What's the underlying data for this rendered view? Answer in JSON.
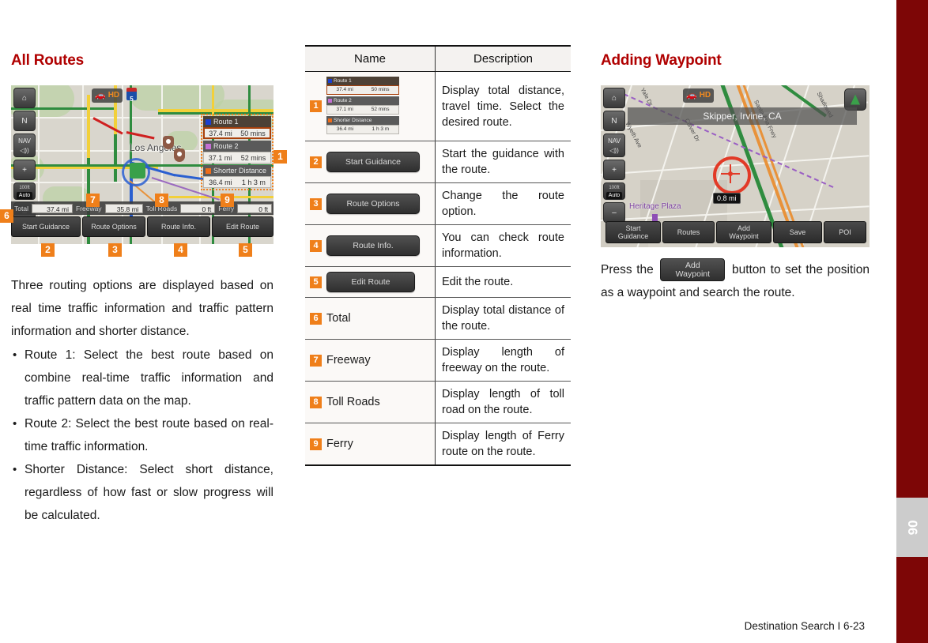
{
  "page": {
    "footer": "Destination Search I 6-23",
    "tab_number": "06",
    "spine_color": "#7d0606",
    "heading_color": "#b00000",
    "callout_color": "#ef7f1a"
  },
  "left": {
    "title": "All Routes",
    "intro": "Three routing options are displayed based on real time traffic information and traffic pattern information and shorter distance.",
    "bullets": [
      "Route 1: Select the best route based on combine real-time traffic information and traffic pattern data on the map.",
      "Route 2: Select the best route based on real-time traffic information.",
      "Shorter Distance: Select short distance, regardless of how fast or slow progress will be calculated."
    ],
    "screenshot": {
      "toolbar": {
        "home": "⌂",
        "north": "N",
        "nav_label": "NAV",
        "mute": "◁))",
        "zoom_in": "+",
        "zoom_out": "–",
        "scale_top": "100ft",
        "scale_auto": "Auto"
      },
      "traffic_badge": {
        "car": "Ὡ7",
        "hd": "HD"
      },
      "highway_shield": "5",
      "city_label": "Los Angeles",
      "routes": [
        {
          "name": "Route 1",
          "distance": "37.4 mi",
          "time": "50 mins",
          "color": "#1c3fd1",
          "selected": true
        },
        {
          "name": "Route 2",
          "distance": "37.1 mi",
          "time": "52 mins",
          "color": "#c46fd4",
          "selected": false
        },
        {
          "name": "Shorter Distance",
          "distance": "36.4 mi",
          "time": "1 h 3 m",
          "color": "#ef6c1a",
          "selected": false
        }
      ],
      "info_strip": [
        {
          "label": "Total",
          "value": "37.4 mi"
        },
        {
          "label": "Freeway",
          "value": "35.8 mi"
        },
        {
          "label": "Toll Roads",
          "value": "0 ft"
        },
        {
          "label": "Ferry",
          "value": "0 ft"
        }
      ],
      "buttons": [
        "Start Guidance",
        "Route Options",
        "Route Info.",
        "Edit Route"
      ],
      "callouts": [
        "1",
        "2",
        "3",
        "4",
        "5",
        "6",
        "7",
        "8",
        "9"
      ]
    }
  },
  "table": {
    "headers": [
      "Name",
      "Description"
    ],
    "rows": [
      {
        "num": "1",
        "kind": "route-stack",
        "routes": [
          {
            "name": "Route 1",
            "distance": "37.4 mi",
            "time": "50 mins",
            "color": "#1c3fd1",
            "selected": true
          },
          {
            "name": "Route 2",
            "distance": "37.1 mi",
            "time": "52 mins",
            "color": "#c46fd4",
            "selected": false
          },
          {
            "name": "Shorter Distance",
            "distance": "36.4 mi",
            "time": "1 h 3 m",
            "color": "#ef6c1a",
            "selected": false
          }
        ],
        "desc": "Display total distance, travel time. Select the desired route."
      },
      {
        "num": "2",
        "kind": "chip",
        "label": "Start Guidance",
        "chip_width": 118,
        "desc": "Start the guidance with the route."
      },
      {
        "num": "3",
        "kind": "chip",
        "label": "Route Options",
        "chip_width": 118,
        "desc": "Change the route option."
      },
      {
        "num": "4",
        "kind": "chip",
        "label": "Route Info.",
        "chip_width": 118,
        "desc": "You can check route information."
      },
      {
        "num": "5",
        "kind": "chip",
        "label": "Edit Route",
        "chip_width": 112,
        "desc": "Edit the route."
      },
      {
        "num": "6",
        "kind": "text",
        "label": "Total",
        "desc": "Display total distance of the route."
      },
      {
        "num": "7",
        "kind": "text",
        "label": "Freeway",
        "desc": "Display length of freeway on the route."
      },
      {
        "num": "8",
        "kind": "text",
        "label": "Toll Roads",
        "desc": "Display length of toll road on the route."
      },
      {
        "num": "9",
        "kind": "text",
        "label": "Ferry",
        "desc": "Display length of Ferry route on the route."
      }
    ]
  },
  "right": {
    "title": "Adding Waypoint",
    "paragraph_before": "Press the",
    "inline_button_line1": "Add",
    "inline_button_line2": "Waypoint",
    "paragraph_after": "button to set the position as a waypoint and search the route.",
    "screenshot": {
      "toolbar": {
        "home": "⌂",
        "north": "N",
        "nav_label": "NAV",
        "mute": "◁))",
        "zoom_in": "+",
        "zoom_out": "–",
        "scale_top": "100ft",
        "scale_auto": "Auto"
      },
      "address": "Skipper, Irvine, CA",
      "distance_tag": "0.8 mi",
      "plaza_label": "Heritage Plaza",
      "street_labels": [
        "Yale Dr",
        "Culver Dr",
        "Wyeth Ave",
        "Santa Ana Frwy",
        "Shadowed"
      ],
      "buttons": [
        {
          "line1": "Start",
          "line2": "Guidance"
        },
        {
          "line1": "Routes",
          "line2": ""
        },
        {
          "line1": "Add",
          "line2": "Waypoint"
        },
        {
          "line1": "Save",
          "line2": ""
        },
        {
          "line1": "POI",
          "line2": ""
        }
      ]
    }
  }
}
